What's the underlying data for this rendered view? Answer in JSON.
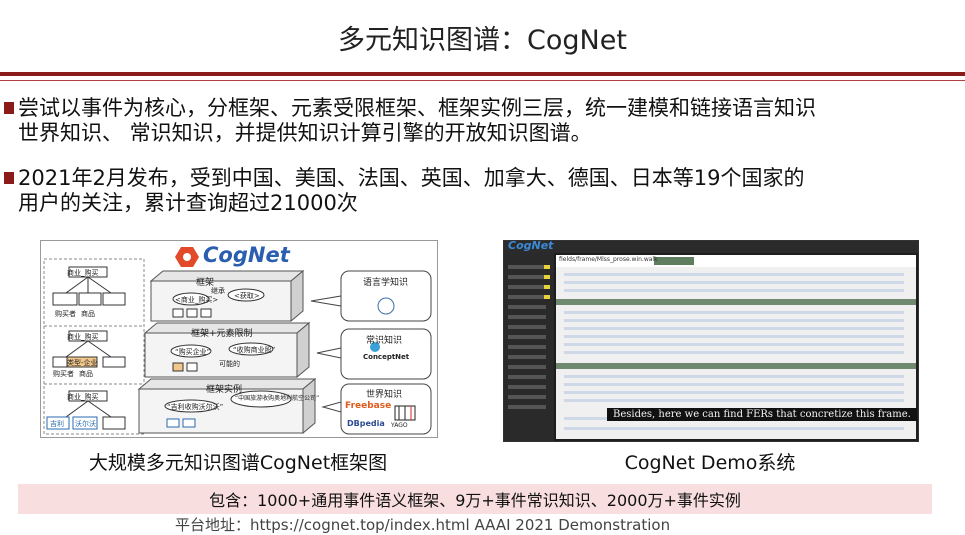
{
  "title": "多元知识图谱：CogNet",
  "bullets": [
    {
      "line1": "尝试以事件为核心，分框架、元素受限框架、框架实例三层，统一建模和链接语言知识",
      "line2": "世界知识、 常识知识，并提供知识计算引擎的开放知识图谱。"
    },
    {
      "line1": "2021年2月发布，受到中国、美国、法国、英国、加拿大、德国、日本等19个国家的",
      "line2": "用户的关注，累计查询超过21000次"
    }
  ],
  "left_figure": {
    "caption": "大规模多元知识图谱CogNet框架图",
    "logo": "CogNet",
    "layers": [
      "框架",
      "框架+元素限制",
      "框架实例"
    ],
    "sources": [
      "语言学知识",
      "常识知识",
      "世界知识"
    ],
    "source_logos": [
      "ConceptNet",
      "Freebase",
      "DBpedia",
      "YAGO"
    ],
    "nodes": {
      "commerce_buy": "商业_购买",
      "buyer": "购买者",
      "goods": "商品",
      "type_enterprise": "类型-企业",
      "gauli": "吉利",
      "volvo": "沃尔沃",
      "frame_small": "<商业_购买>",
      "acquire": "<获取>",
      "inherit": "继承",
      "buy_enterprise": "“购买企业”",
      "brand_acquire": "“收购商业股”",
      "possible": "可能的",
      "instance1": "“吉利收购沃尔沃”",
      "instance2": "“中国旅游收购奥地利航空公司”"
    }
  },
  "right_figure": {
    "caption": "CogNet Demo系统",
    "logo": "CogNet",
    "breadcrumb": "fields/frame/Mlss_prose.win.walk",
    "tooltip": "Besides, here we can find FERs that concretize this frame."
  },
  "band_text": "包含：1000+通用事件语义框架、9万+事件常识知识、2000万+事件实例",
  "cut_text": "平台地址：https://cognet.top/index.html    AAAI 2021 Demonstration"
}
